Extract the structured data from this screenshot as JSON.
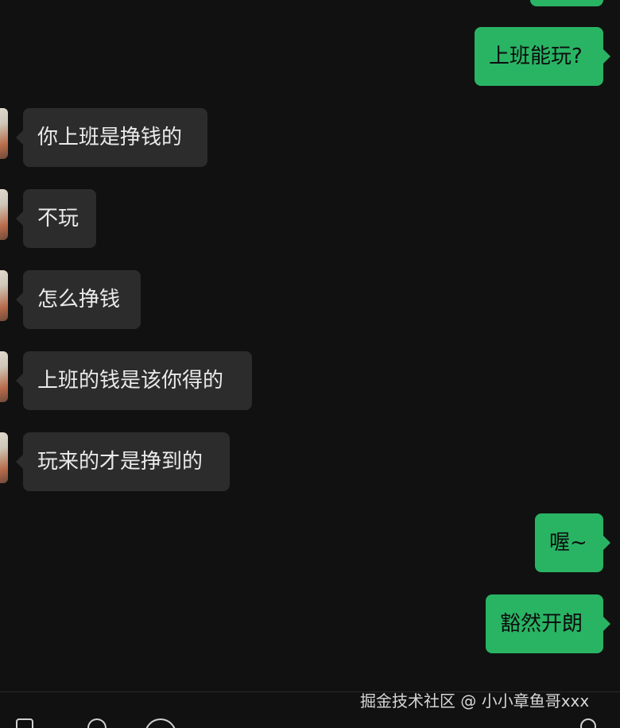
{
  "messages": [
    {
      "side": "out",
      "text": ""
    },
    {
      "side": "out",
      "text": "上班能玩?"
    },
    {
      "side": "in",
      "text": "你上班是挣钱的"
    },
    {
      "side": "in",
      "text": "不玩"
    },
    {
      "side": "in",
      "text": "怎么挣钱"
    },
    {
      "side": "in",
      "text": "上班的钱是该你得的"
    },
    {
      "side": "in",
      "text": "玩来的才是挣到的"
    },
    {
      "side": "out",
      "text": "喔~"
    },
    {
      "side": "out",
      "text": "豁然开朗"
    }
  ],
  "watermark": "掘金技术社区 @ 小小章鱼哥xxx",
  "colors": {
    "background": "#111111",
    "incoming_bubble": "#2c2c2c",
    "outgoing_bubble": "#29b464"
  }
}
